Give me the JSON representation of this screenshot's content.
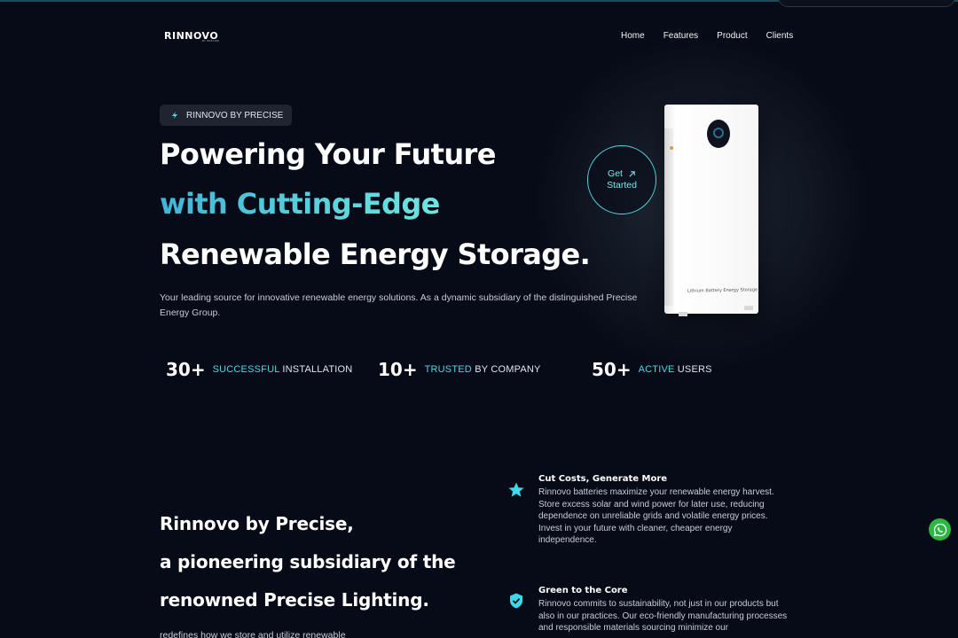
{
  "header": {
    "logo": "RINNOVO",
    "logo_sub": "BY PRECISE",
    "nav": [
      "Home",
      "Features",
      "Product",
      "Clients"
    ]
  },
  "hero": {
    "badge_brand": "RINNOVO",
    "badge_rest": " BY PRECISE",
    "line1": "Powering Your Future",
    "line2": "with Cutting-Edge",
    "line3": "Renewable Energy Storage.",
    "lead": "Your leading source for innovative renewable energy solutions. As a dynamic subsidiary of the distinguished Precise Energy Group.",
    "cta_line1": "Get",
    "cta_line2": "Started",
    "device_label": "Lithium Battery Energy Storage"
  },
  "stats": [
    {
      "num": "30+",
      "accent": "SUCCESSFUL",
      "rest": " INSTALLATION"
    },
    {
      "num": "10+",
      "accent": "TRUSTED",
      "rest": " BY COMPANY"
    },
    {
      "num": "50+",
      "accent": "ACTIVE",
      "rest": " USERS"
    }
  ],
  "about": {
    "line1": "Rinnovo by Precise,",
    "line2": "a pioneering subsidiary of the",
    "line3": "renowned Precise Lighting.",
    "body": "redefines how we store and utilize renewable"
  },
  "features": [
    {
      "icon": "star-icon",
      "title": "Cut Costs, Generate More",
      "desc": "Rinnovo batteries maximize your renewable energy harvest. Store excess solar and wind power for later use, reducing dependence on unreliable grids and volatile energy prices. Invest in your future with cleaner, cheaper energy independence."
    },
    {
      "icon": "shield-check-icon",
      "title": "Green to the Core",
      "desc": "Rinnovo commits to sustainability, not just in our products but also in our practices. Our eco-friendly manufacturing processes and responsible materials sourcing minimize our"
    }
  ],
  "colors": {
    "background": "#070b17",
    "accent": "#4fd6e0",
    "whatsapp": "#2bb741"
  }
}
